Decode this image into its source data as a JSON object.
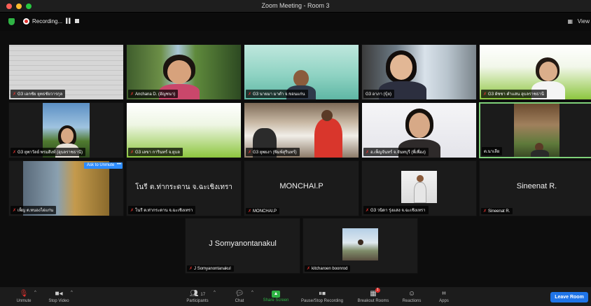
{
  "window": {
    "title": "Zoom Meeting - Room 3",
    "traffic_colors": [
      "#ff5f57",
      "#febc2e",
      "#28c840"
    ]
  },
  "status": {
    "recording_label": "Recording...",
    "view_label": "View"
  },
  "participants": [
    {
      "name": "G3 เอกชัย ยุทธชัยวารกุล",
      "display": ""
    },
    {
      "name": "Anchana D. (อัญชนา)",
      "display": ""
    },
    {
      "name": "G3 นายมา มาตำ จ.ขอนแก่น",
      "display": ""
    },
    {
      "name": "G3 อาภา (บุ้ย)",
      "display": ""
    },
    {
      "name": "G3 ผัชชา คำแสน อุบลราชธานี",
      "display": ""
    },
    {
      "name": "G3 ยุพาวัลย์ พรมสิงห์ (อุบลราชธานี)",
      "display": ""
    },
    {
      "name": "G3 เลขา การินทร์ จ.ยุบล",
      "display": ""
    },
    {
      "name": "G3 ยุพยงา (พิมพ์สุรินทร์)",
      "display": ""
    },
    {
      "name": "อ.เพ็ญจันทร์ จ.จันทบุรี (พี่เพื่อง)",
      "display": ""
    },
    {
      "name": "ต.นาเลีย",
      "display": ""
    },
    {
      "name": "เพ็ญ ต.หนองไผ่แก่น",
      "display": ""
    },
    {
      "name": "โนรี ต.ท่ากระดาน จ.ฉะเชิงเทรา",
      "display": "โนรี ต.ท่ากระดาน จ.ฉะเชิงเทรา"
    },
    {
      "name": "MONCHAI.P",
      "display": "MONCHAI.P"
    },
    {
      "name": "G3 วนิดา รุ่งแสง จ.ฉะเชิงเทรา",
      "display": ""
    },
    {
      "name": "Sineenat R.",
      "display": "Sineenat R."
    },
    {
      "name": "J Somyanontanakul",
      "display": "J Somyanontanakul"
    },
    {
      "name": "kitcharoen boonrod",
      "display": ""
    }
  ],
  "ask_to_unmute": "Ask to Unmute",
  "more_glyph": "•••",
  "toolbar": {
    "unmute": "Unmute",
    "stop_video": "Stop Video",
    "participants": "Participants",
    "participants_count": "17",
    "chat": "Chat",
    "share_screen": "Share Screen",
    "pause_recording": "Pause/Stop Recording",
    "breakout_rooms": "Breakout Rooms",
    "reactions": "Reactions",
    "apps": "Apps",
    "leave_room": "Leave Room"
  },
  "colors": {
    "accent_green": "#2fb344",
    "mic_off_red": "#e0312e",
    "leave_blue": "#1f74e8",
    "ask_blue": "#2d8cff"
  }
}
